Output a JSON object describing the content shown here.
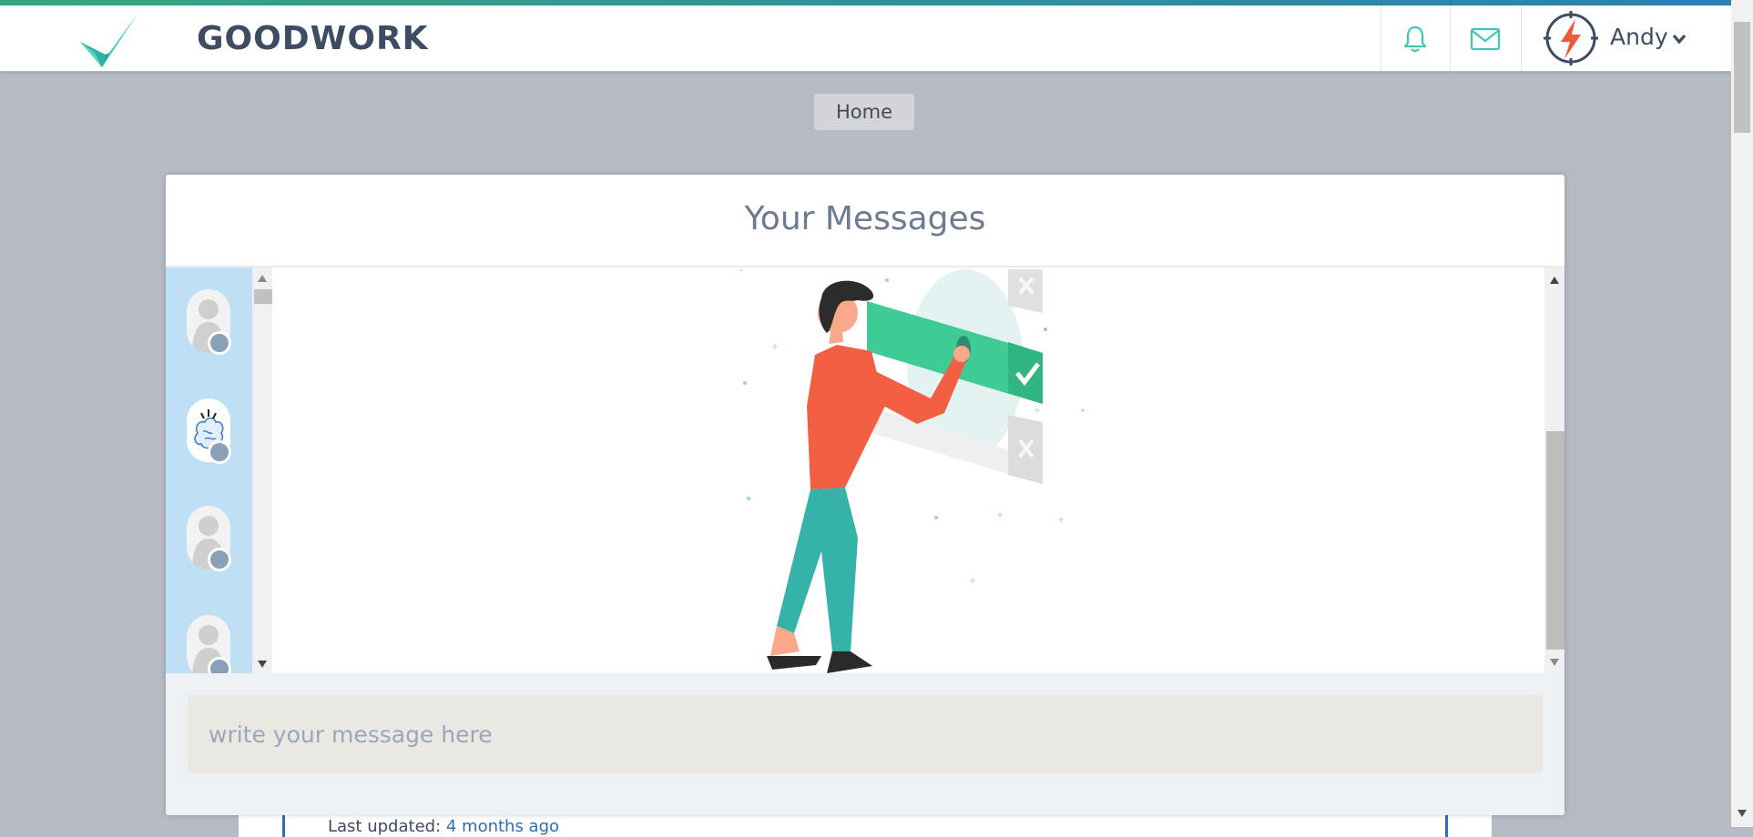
{
  "brand": {
    "name": "GOODWORK"
  },
  "header": {
    "user_name": "Andy",
    "icons": [
      "bell-icon",
      "mail-icon",
      "chevron-down-icon"
    ],
    "accent_color": "#3ec6b6"
  },
  "breadcrumb": {
    "home_label": "Home"
  },
  "messages_panel": {
    "title": "Your Messages",
    "compose_placeholder": "write your message here",
    "contact_count_visible": 4
  },
  "background_card": {
    "updated_prefix": "Last updated: ",
    "updated_value": "4 months ago"
  }
}
